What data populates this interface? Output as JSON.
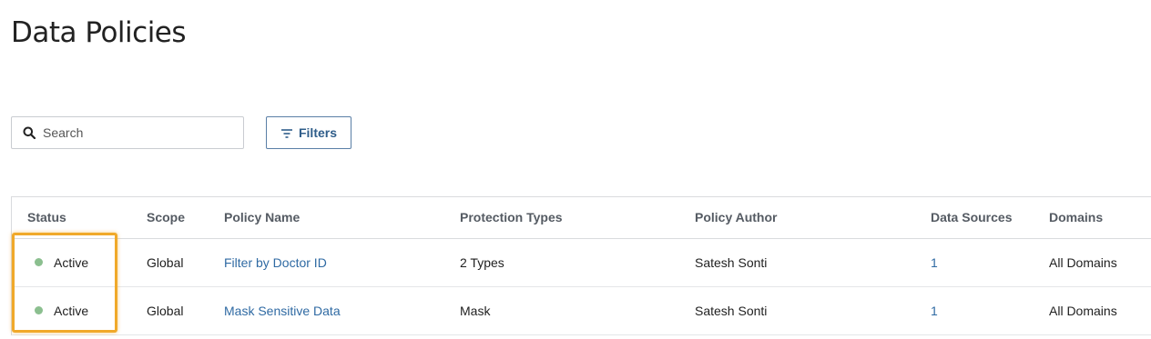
{
  "page": {
    "title": "Data Policies"
  },
  "toolbar": {
    "search_placeholder": "Search",
    "filters_label": "Filters"
  },
  "table": {
    "columns": [
      "Status",
      "Scope",
      "Policy Name",
      "Protection Types",
      "Policy Author",
      "Data Sources",
      "Domains"
    ],
    "rows": [
      {
        "status": "Active",
        "scope": "Global",
        "policy_name": "Filter by Doctor ID",
        "protection_types": "2 Types",
        "policy_author": "Satesh Sonti",
        "data_sources": "1",
        "domains": "All Domains"
      },
      {
        "status": "Active",
        "scope": "Global",
        "policy_name": "Mask Sensitive Data",
        "protection_types": "Mask",
        "policy_author": "Satesh Sonti",
        "data_sources": "1",
        "domains": "All Domains"
      }
    ]
  },
  "colors": {
    "active_status": "#8bbf8f",
    "highlight": "#f0a92a",
    "link": "#2f6aa3"
  }
}
